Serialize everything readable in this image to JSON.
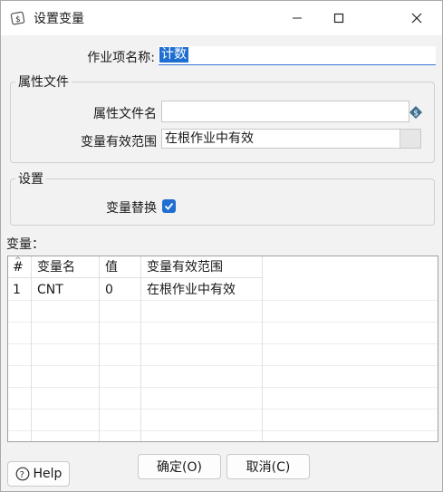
{
  "window": {
    "title": "设置变量"
  },
  "job_name": {
    "label": "作业项名称:",
    "value": "计数"
  },
  "properties_file": {
    "group_label": "属性文件",
    "file_name_label": "属性文件名",
    "file_name_value": "",
    "scope_label": "变量有效范围",
    "scope_value": "在根作业中有效"
  },
  "settings": {
    "group_label": "设置",
    "replace_label": "变量替换",
    "replace_checked": true
  },
  "variables": {
    "label": "变量：",
    "sort_arrow": "^",
    "columns": [
      "#",
      "变量名",
      "值",
      "变量有效范围"
    ],
    "rows": [
      [
        "1",
        "CNT",
        "0",
        "在根作业中有效"
      ]
    ]
  },
  "buttons": {
    "ok": "确定(O)",
    "cancel": "取消(C)",
    "help": "Help"
  }
}
